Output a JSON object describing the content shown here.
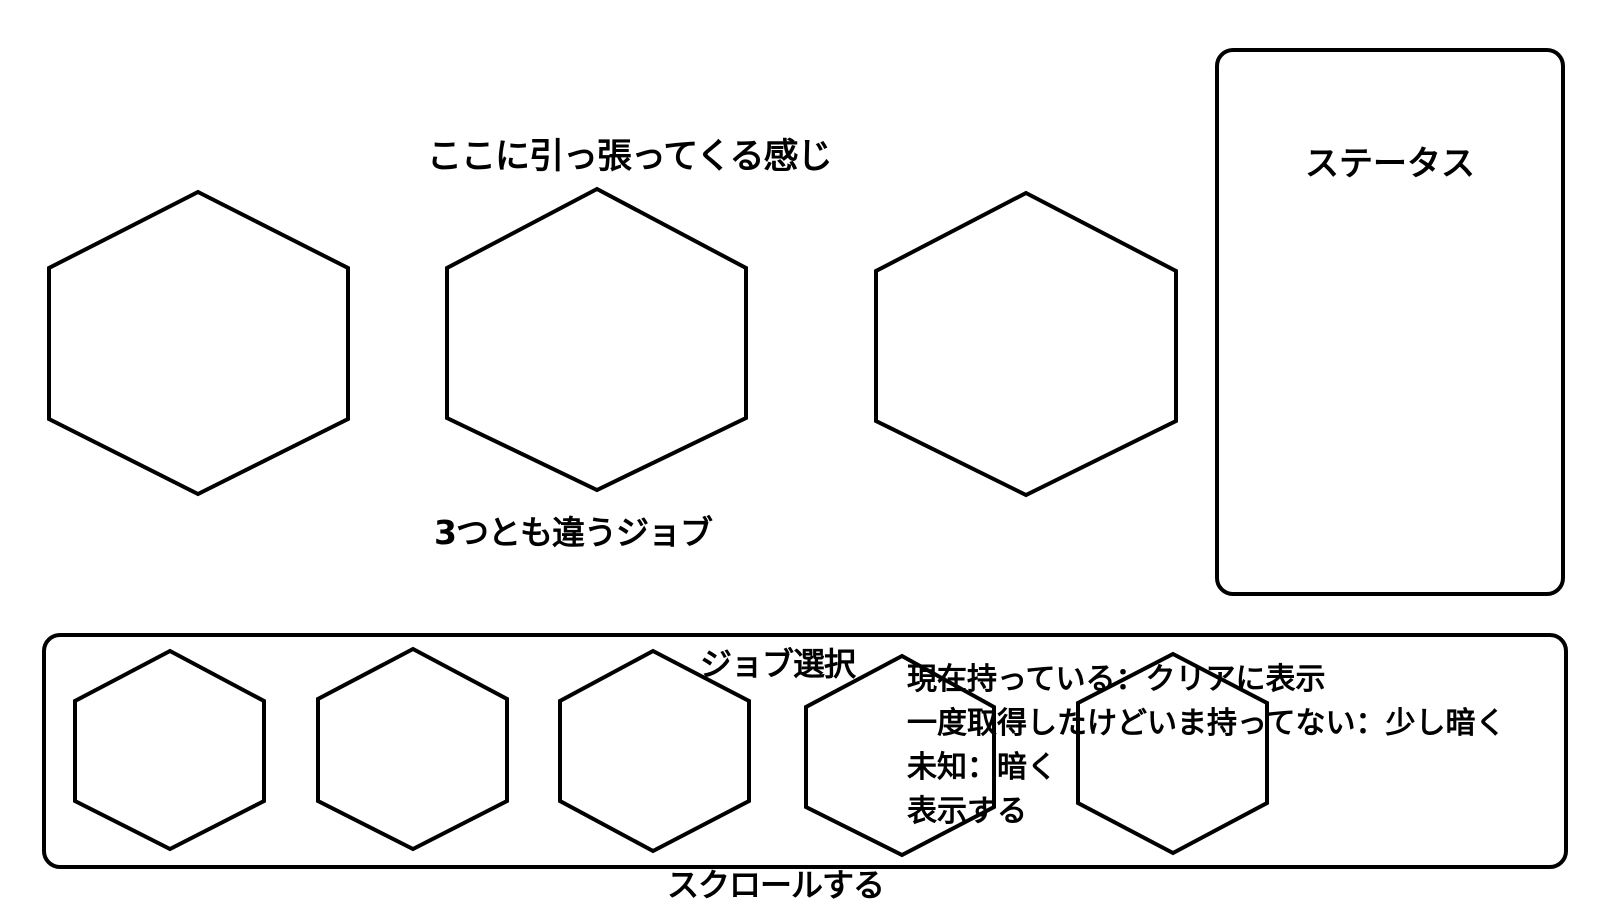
{
  "top_area": {
    "pull_here_label": "ここに引っ張ってくる感じ",
    "different_jobs_label": "3つとも違うジョブ"
  },
  "status_panel": {
    "title": "ステータス"
  },
  "job_selection": {
    "title": "ジョブ選択",
    "notes": [
      "現在持っている：クリアに表示",
      "一度取得したけどいま持ってない：少し暗く",
      "未知：暗く",
      "表示する"
    ],
    "scroll_label": "スクロールする"
  }
}
